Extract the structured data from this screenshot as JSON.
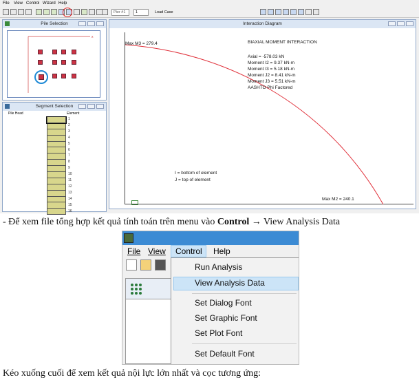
{
  "screen1": {
    "menu": [
      "File",
      "View",
      "Control",
      "Wizard",
      "Help"
    ],
    "toolbar": {
      "pier_select": "Pier #1",
      "load_case_value": "1",
      "load_case_label": "Load Case"
    },
    "pile_selection": {
      "title": "Pile Selection"
    },
    "segment_selection": {
      "title": "Segment Selection",
      "col_pile_head": "Pile Head",
      "col_element": "Element",
      "elements": [
        "1",
        "2",
        "3",
        "4",
        "5",
        "6",
        "7",
        "8",
        "9",
        "10",
        "11",
        "12",
        "13",
        "14",
        "15",
        "16"
      ]
    },
    "interaction_diagram": {
      "title": "Interaction Diagram",
      "max_m3": "Max M3 = 279.4",
      "heading": "BIAXIAL MOMENT INTERACTION",
      "axial": "Axial = -578.03 kN",
      "moment_i2": "Moment I2 = 9.37 kN-m",
      "moment_i3": "Moment I3 = 5.18 kN-m",
      "moment_j2": "Moment J2 = 8.41 kN-m",
      "moment_j3": "Moment J3 = 5.51 kN-m",
      "factored": "AASHTO Phi Factored",
      "legend_i": "I = bottom of element",
      "legend_j": "J = top of element",
      "max_m2": "Max M2 = 240.1"
    }
  },
  "caption1_prefix": "- Để xem file tổng hợp kết quả tính toán trên menu vào ",
  "caption1_bold": "Control",
  "caption1_suffix": " → View Analysis Data",
  "screen2": {
    "menu": [
      "File",
      "View",
      "Control",
      "Help"
    ],
    "dropdown": [
      "Run Analysis",
      "View Analysis Data",
      "Set Dialog Font",
      "Set Graphic Font",
      "Set Plot Font",
      "Set Default Font"
    ]
  },
  "caption2": "Kéo xuống cuối để xem kết quả nội lực lớn nhất và cọc tương ứng:",
  "colors": {
    "curve": "#e0303a",
    "pile": "#cc3344",
    "highlight": "#cce4f7",
    "segment": "#d8d68c"
  }
}
